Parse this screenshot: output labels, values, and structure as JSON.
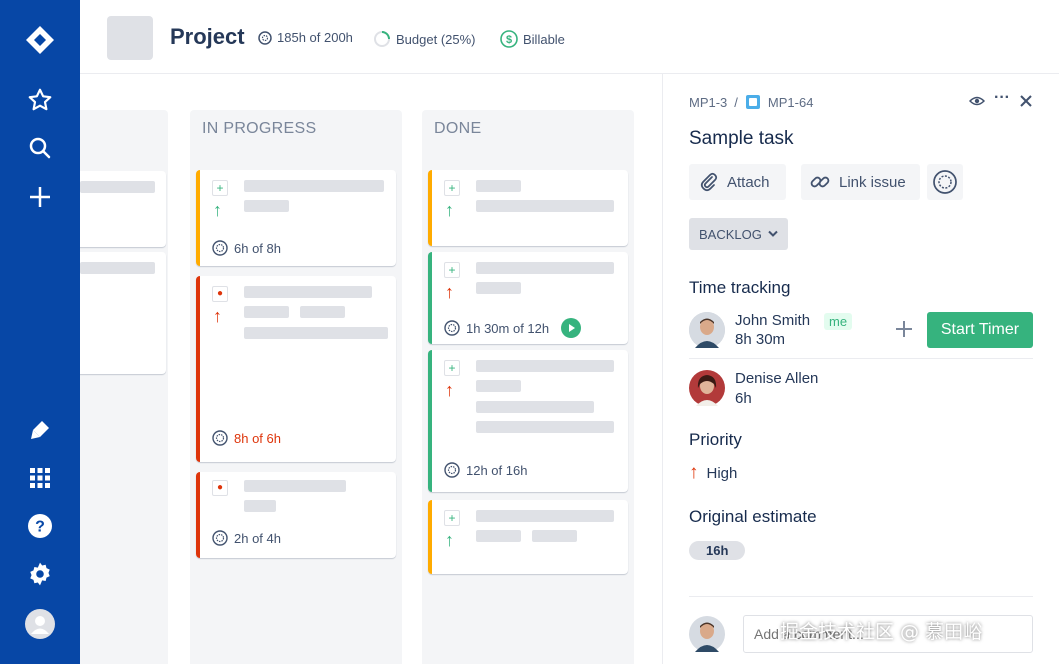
{
  "header": {
    "title": "Project",
    "hours": "185h of 200h",
    "budget": "Budget (25%)",
    "billable": "Billable"
  },
  "columns": {
    "in_progress": "IN PROGRESS",
    "done": "DONE"
  },
  "cards": {
    "ip1_time": "6h of 8h",
    "ip2_time": "8h of 6h",
    "ip3_time": "2h of 4h",
    "d2_time": "1h 30m of 12h",
    "d3_time": "12h of 16h"
  },
  "panel": {
    "breadcrumb_parent": "MP1-3",
    "breadcrumb_sep": "/",
    "breadcrumb_issue": "MP1-64",
    "title": "Sample task",
    "attach_label": "Attach",
    "link_label": "Link issue",
    "status": "BACKLOG",
    "time_tracking_title": "Time tracking",
    "users": [
      {
        "name": "John Smith",
        "time": "8h 30m",
        "badge": "me"
      },
      {
        "name": "Denise Allen",
        "time": "6h"
      }
    ],
    "start_timer": "Start Timer",
    "priority_title": "Priority",
    "priority_value": "High",
    "estimate_title": "Original estimate",
    "estimate_value": "16h",
    "comment_placeholder": "Add a comment..."
  },
  "colors": {
    "nav": "#0747a6",
    "green": "#36b37e",
    "red": "#de350b",
    "orange": "#ffab00"
  },
  "watermark": "掘金技术社区 @ 慕田峪"
}
